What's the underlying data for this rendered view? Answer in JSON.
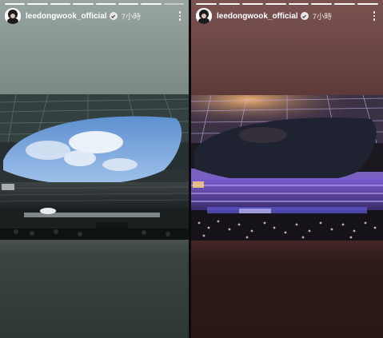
{
  "stories": [
    {
      "username": "leedongwook_official",
      "time": "7小時",
      "progress": {
        "segments": 8,
        "completed": 7
      },
      "photo": {
        "scene": "stadium-daytime",
        "sky_color": "#6f9fd8",
        "roof_color": "#2f3a3c"
      }
    },
    {
      "username": "leedongwook_official",
      "time": "7小時",
      "progress": {
        "segments": 8,
        "completed": 8
      },
      "photo": {
        "scene": "stadium-night-concert",
        "sky_color": "#1f2230",
        "roof_color": "#3a2a4a",
        "light_color": "#9a6cff"
      }
    }
  ],
  "colors": {
    "left_bg": "#6c7776",
    "right_bg": "#4c2d2b",
    "text": "#ffffff"
  },
  "icons": {
    "verified": "verified-badge-icon",
    "more": "more-vertical-icon",
    "avatar": "profile-avatar"
  }
}
